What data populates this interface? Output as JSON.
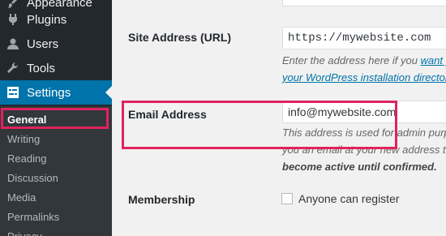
{
  "sidebar": {
    "items": [
      {
        "label": "Appearance",
        "icon": "paintbrush-icon"
      },
      {
        "label": "Plugins",
        "icon": "plugin-icon"
      },
      {
        "label": "Users",
        "icon": "users-icon"
      },
      {
        "label": "Tools",
        "icon": "wrench-icon"
      },
      {
        "label": "Settings",
        "icon": "settings-icon"
      }
    ],
    "submenu": [
      "General",
      "Writing",
      "Reading",
      "Discussion",
      "Media",
      "Permalinks",
      "Privacy"
    ]
  },
  "form": {
    "site_address": {
      "label": "Site Address (URL)",
      "value": "https://mywebsite.com",
      "desc_line1_plain": "Enter the address here if you ",
      "desc_line1_link": "want y",
      "desc_line2_link": "your WordPress installation director"
    },
    "email": {
      "label": "Email Address",
      "value": "info@mywebsite.com",
      "desc_line1": "This address is used for admin purp",
      "desc_line2": "you an email at your new address to",
      "desc_line3": "become active until confirmed."
    },
    "membership": {
      "label": "Membership",
      "checkbox_label": "Anyone can register"
    }
  },
  "colors": {
    "sidebar_bg": "#23282d",
    "submenu_bg": "#32373c",
    "accent_blue": "#0073aa",
    "highlight": "#e0235e"
  }
}
